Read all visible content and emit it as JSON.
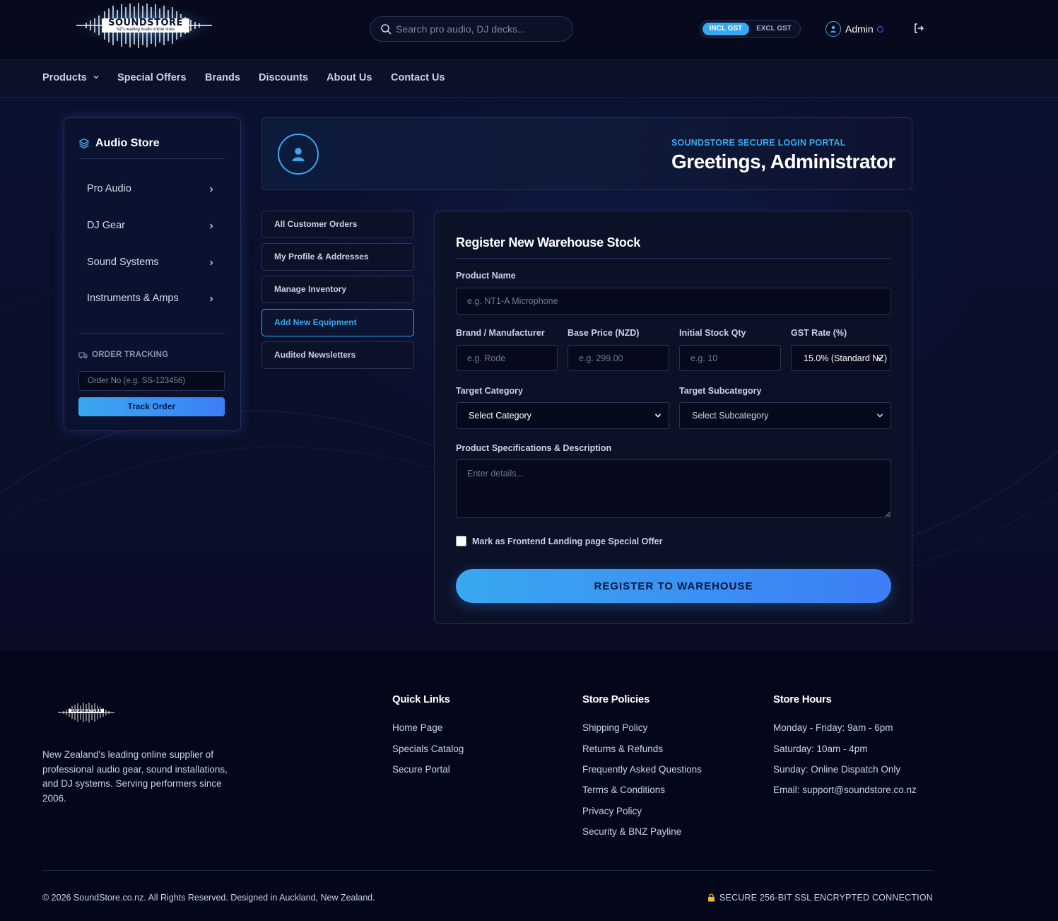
{
  "header": {
    "logo_text": "SOUNDSTORE",
    "logo_tagline": "NZ's leading Audio online store",
    "search_placeholder": "Search pro audio, DJ decks...",
    "gst_incl": "INCL GST",
    "gst_excl": "EXCL GST",
    "user_name": "Admin"
  },
  "nav": {
    "items": [
      "Products",
      "Special Offers",
      "Brands",
      "Discounts",
      "About Us",
      "Contact Us"
    ]
  },
  "sidebar": {
    "title": "Audio Store",
    "categories": [
      "Pro Audio",
      "DJ Gear",
      "Sound Systems",
      "Instruments & Amps"
    ],
    "tracking_label": "ORDER TRACKING",
    "tracking_placeholder": "Order No (e.g. SS-123456)",
    "track_button": "Track Order"
  },
  "greeting": {
    "kicker": "SOUNDSTORE SECURE LOGIN PORTAL",
    "title": "Greetings, Administrator"
  },
  "admin_tabs": {
    "items": [
      "All Customer Orders",
      "My Profile & Addresses",
      "Manage Inventory",
      "Add New Equipment",
      "Audited Newsletters"
    ],
    "active": "Add New Equipment"
  },
  "form": {
    "title": "Register New Warehouse Stock",
    "product_name_label": "Product Name",
    "product_name_placeholder": "e.g. NT1-A Microphone",
    "brand_label": "Brand / Manufacturer",
    "brand_placeholder": "e.g. Rode",
    "price_label": "Base Price (NZD)",
    "price_placeholder": "e.g. 299.00",
    "qty_label": "Initial Stock Qty",
    "qty_placeholder": "e.g. 10",
    "gst_label": "GST Rate (%)",
    "gst_value": "15.0% (Standard NZ)",
    "category_label": "Target Category",
    "category_value": "Select Category",
    "subcategory_label": "Target Subcategory",
    "subcategory_value": "Select Subcategory",
    "description_label": "Product Specifications & Description",
    "description_placeholder": "Enter details...",
    "special_offer_label": "Mark as Frontend Landing page Special Offer",
    "special_offer_checked": false,
    "submit_label": "REGISTER TO WAREHOUSE"
  },
  "footer": {
    "logo_text": "SOUNDSTORE",
    "about": "New Zealand's leading online supplier of professional audio gear, sound installations, and DJ systems. Serving performers since 2006.",
    "quick_links_title": "Quick Links",
    "quick_links": [
      "Home Page",
      "Specials Catalog",
      "Secure Portal"
    ],
    "policies_title": "Store Policies",
    "policies": [
      "Shipping Policy",
      "Returns & Refunds",
      "Frequently Asked Questions",
      "Terms & Conditions",
      "Privacy Policy",
      "Security & BNZ Payline"
    ],
    "hours_title": "Store Hours",
    "hours": [
      "Monday - Friday: 9am - 6pm",
      "Saturday: 10am - 4pm",
      "Sunday: Online Dispatch Only",
      "Email: support@soundstore.co.nz"
    ],
    "copyright": "© 2026 SoundStore.co.nz. All Rights Reserved. Designed in Auckland, New Zealand.",
    "secure_text": "SECURE 256-BIT SSL ENCRYPTED CONNECTION"
  },
  "colors": {
    "accent": "#38a8f0",
    "accent_2": "#3d7ef5",
    "background": "#070b1e",
    "panel": "#0b1126",
    "status_ring": "#8a4cf0"
  }
}
